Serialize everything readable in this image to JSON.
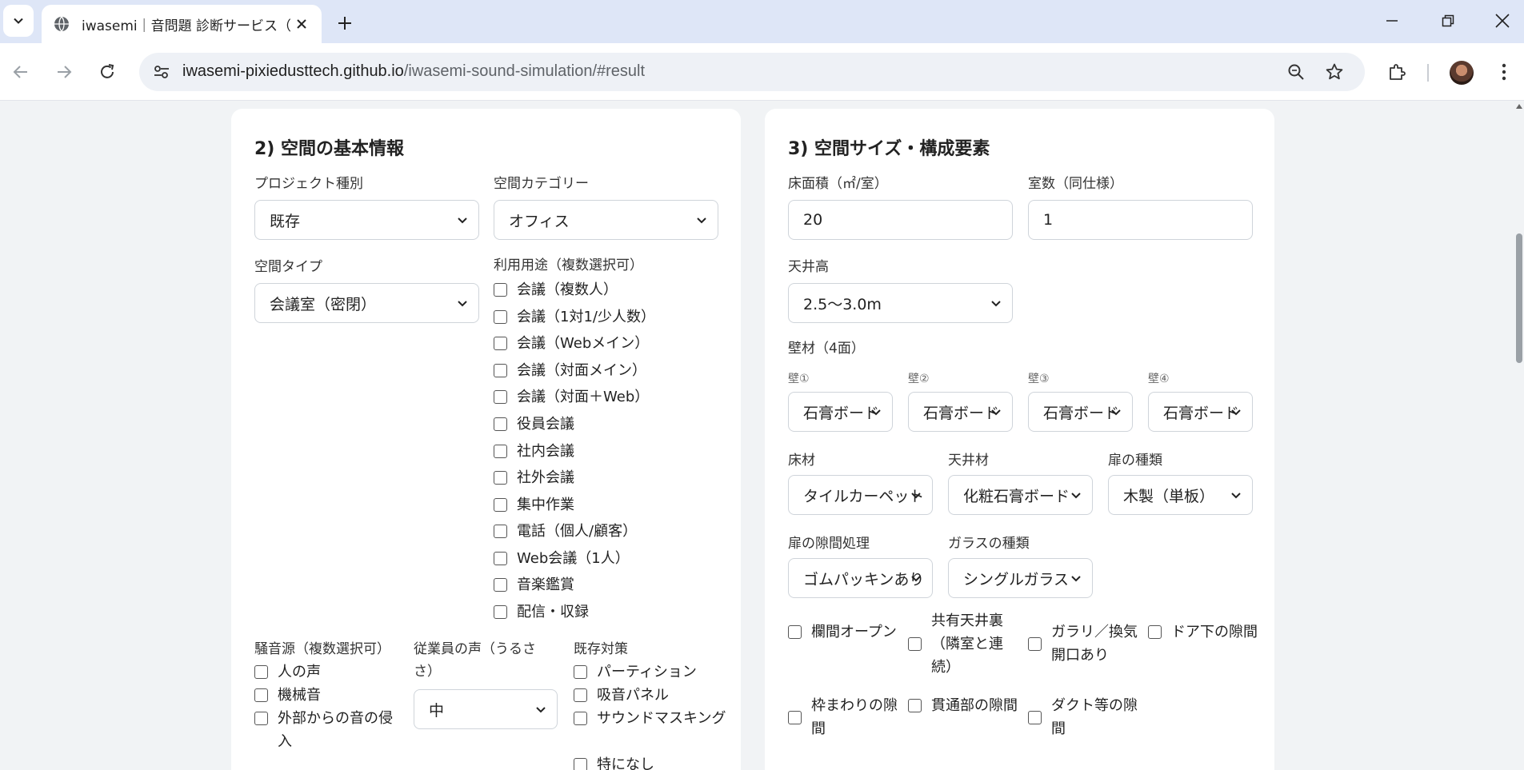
{
  "browser": {
    "tab_title": "iwasemi｜音問題 診断サービス（",
    "url_host": "iwasemi-pixiedusttech.github.io",
    "url_path": "/iwasemi-sound-simulation/#result"
  },
  "section2": {
    "title": "2) 空間の基本情報",
    "project_type": {
      "label": "プロジェクト種別",
      "value": "既存"
    },
    "space_category": {
      "label": "空間カテゴリー",
      "value": "オフィス"
    },
    "space_type": {
      "label": "空間タイプ",
      "value": "会議室（密閉）"
    },
    "usage": {
      "label": "利用用途（複数選択可）",
      "items": [
        "会議（複数人）",
        "会議（1対1/少人数）",
        "会議（Webメイン）",
        "会議（対面メイン）",
        "会議（対面＋Web）",
        "役員会議",
        "社内会議",
        "社外会議",
        "集中作業",
        "電話（個人/顧客）",
        "Web会議（1人）",
        "音楽鑑賞",
        "配信・収録"
      ]
    },
    "noise_source": {
      "label": "騒音源（複数選択可）",
      "items": [
        "人の声",
        "機械音",
        "外部からの音の侵入"
      ]
    },
    "employee_voice": {
      "label": "従業員の声（うるささ）",
      "value": "中"
    },
    "existing_measures": {
      "label": "既存対策",
      "items": [
        "パーティション",
        "吸音パネル",
        "サウンドマスキング",
        "特になし"
      ]
    }
  },
  "section3": {
    "title": "3) 空間サイズ・構成要素",
    "floor_area": {
      "label": "床面積（㎡/室）",
      "value": "20"
    },
    "room_count": {
      "label": "室数（同仕様）",
      "value": "1"
    },
    "ceiling_height": {
      "label": "天井高",
      "value": "2.5〜3.0m"
    },
    "walls": {
      "label": "壁材（4面）",
      "items": [
        {
          "label": "壁①",
          "value": "石膏ボード"
        },
        {
          "label": "壁②",
          "value": "石膏ボード"
        },
        {
          "label": "壁③",
          "value": "石膏ボード"
        },
        {
          "label": "壁④",
          "value": "石膏ボード"
        }
      ]
    },
    "floor_material": {
      "label": "床材",
      "value": "タイルカーペット"
    },
    "ceiling_material": {
      "label": "天井材",
      "value": "化粧石膏ボード"
    },
    "door_type": {
      "label": "扉の種類",
      "value": "木製（単板）"
    },
    "door_gap": {
      "label": "扉の隙間処理",
      "value": "ゴムパッキンあり"
    },
    "glass_type": {
      "label": "ガラスの種類",
      "value": "シングルガラス"
    },
    "openings": [
      "欄間オープン",
      "共有天井裏（隣室と連続）",
      "ガラリ／換気開口あり",
      "ドア下の隙間",
      "枠まわりの隙間",
      "貫通部の隙間",
      "ダクト等の隙間"
    ]
  }
}
